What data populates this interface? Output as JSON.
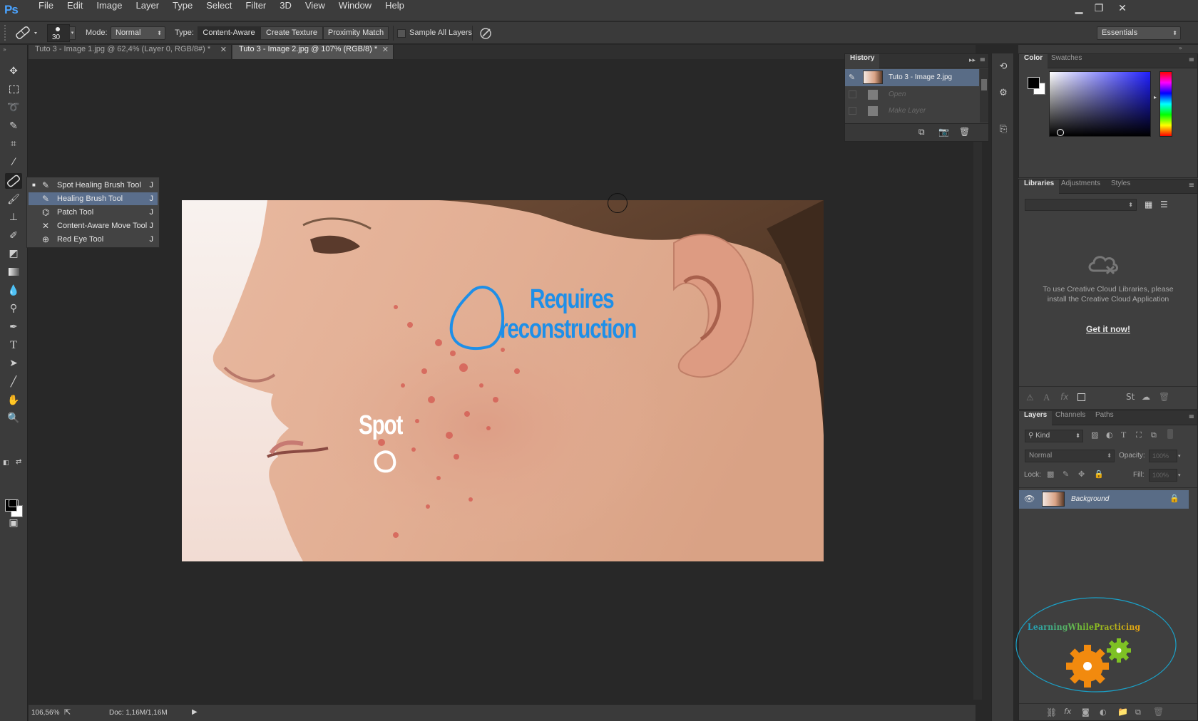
{
  "menubar": {
    "logo": "Ps",
    "menus": [
      "File",
      "Edit",
      "Image",
      "Layer",
      "Type",
      "Select",
      "Filter",
      "3D",
      "View",
      "Window",
      "Help"
    ]
  },
  "options": {
    "brush_size": "30",
    "mode_label": "Mode:",
    "mode_value": "Normal",
    "type_label": "Type:",
    "type_buttons": [
      "Content-Aware",
      "Create Texture",
      "Proximity Match"
    ],
    "sample_all_layers": "Sample All Layers",
    "workspace": "Essentials"
  },
  "tabs": [
    {
      "label": "Tuto 3 - Image 1.jpg @ 62,4% (Layer 0, RGB/8#) *",
      "active": false
    },
    {
      "label": "Tuto 3 - Image 2.jpg @ 107% (RGB/8) *",
      "active": true
    }
  ],
  "flyout": {
    "items": [
      {
        "label": "Spot Healing Brush Tool",
        "key": "J",
        "icon": "spot-healing-brush-icon",
        "current": true
      },
      {
        "label": "Healing Brush Tool",
        "key": "J",
        "icon": "healing-brush-icon",
        "highlight": true
      },
      {
        "label": "Patch Tool",
        "key": "J",
        "icon": "patch-icon"
      },
      {
        "label": "Content-Aware Move Tool",
        "key": "J",
        "icon": "content-aware-move-icon"
      },
      {
        "label": "Red Eye Tool",
        "key": "J",
        "icon": "red-eye-icon"
      }
    ]
  },
  "canvas": {
    "annotation_reconstruction_1": "Requires",
    "annotation_reconstruction_2": "reconstruction",
    "annotation_spot": "Spot",
    "annotation_color": "#1e8fe8"
  },
  "status": {
    "zoom": "106,56%",
    "doc": "Doc: 1,16M/1,16M"
  },
  "history": {
    "title": "History",
    "snapshot": "Tuto 3 - Image 2.jpg",
    "steps": [
      "Open",
      "Make Layer"
    ]
  },
  "color_panel": {
    "tabs": [
      "Color",
      "Swatches"
    ]
  },
  "libraries_panel": {
    "tabs": [
      "Libraries",
      "Adjustments",
      "Styles"
    ],
    "message": "To use Creative Cloud Libraries, please install the Creative Cloud Application",
    "link": "Get it now!"
  },
  "layers_panel": {
    "tabs": [
      "Layers",
      "Channels",
      "Paths"
    ],
    "kind": "Kind",
    "blend": "Normal",
    "opacity_label": "Opacity:",
    "opacity_value": "100%",
    "lock_label": "Lock:",
    "fill_label": "Fill:",
    "fill_value": "100%",
    "layers": [
      {
        "name": "Background",
        "visible": true,
        "locked": true
      }
    ]
  },
  "watermark": {
    "text": "LearningWhilePracticing"
  }
}
